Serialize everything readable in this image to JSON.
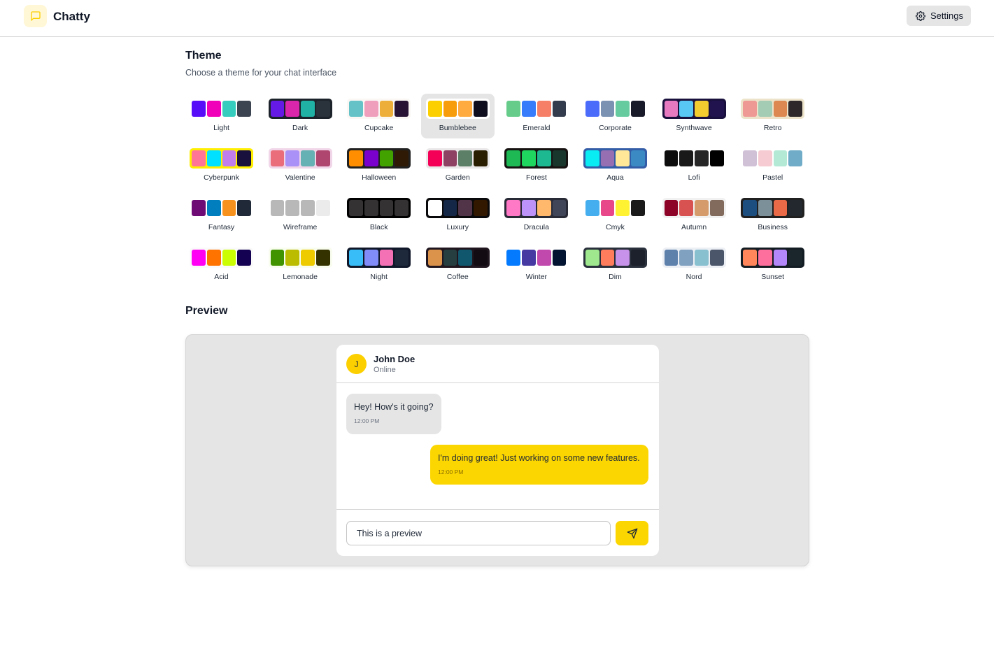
{
  "header": {
    "app_title": "Chatty",
    "settings_label": "Settings",
    "accent": "#fcd600"
  },
  "theme_section": {
    "title": "Theme",
    "subtitle": "Choose a theme for your chat interface",
    "selected": "Bumblebee",
    "themes": [
      {
        "name": "Light",
        "frame": "#ffffff",
        "colors": [
          "#570df8",
          "#f000b8",
          "#37cdbe",
          "#3d4451"
        ]
      },
      {
        "name": "Dark",
        "frame": "#1d232a",
        "colors": [
          "#661ae6",
          "#d926aa",
          "#1fb2a5",
          "#2a323c"
        ]
      },
      {
        "name": "Cupcake",
        "frame": "#faf7f5",
        "colors": [
          "#65c3c8",
          "#ef9fbc",
          "#eeaf3a",
          "#291334"
        ]
      },
      {
        "name": "Bumblebee",
        "frame": "#ffffff",
        "colors": [
          "#fcd000",
          "#f79d0b",
          "#ffab40",
          "#0e0e1f"
        ]
      },
      {
        "name": "Emerald",
        "frame": "#ffffff",
        "colors": [
          "#66cc8a",
          "#377cfb",
          "#f68067",
          "#333c4d"
        ]
      },
      {
        "name": "Corporate",
        "frame": "#ffffff",
        "colors": [
          "#4b6bfb",
          "#7b92b2",
          "#67cba0",
          "#181a2a"
        ]
      },
      {
        "name": "Synthwave",
        "frame": "#1a103d",
        "colors": [
          "#e779c1",
          "#58c7f3",
          "#f3cc30",
          "#20134e"
        ]
      },
      {
        "name": "Retro",
        "frame": "#ece3ca",
        "colors": [
          "#ef9995",
          "#a4cbb4",
          "#dc8850",
          "#2e282a"
        ]
      },
      {
        "name": "Cyberpunk",
        "frame": "#ffee00",
        "colors": [
          "#ff7598",
          "#00e0ff",
          "#c07eec",
          "#1a103d"
        ]
      },
      {
        "name": "Valentine",
        "frame": "#f0d6e8",
        "colors": [
          "#e96d7b",
          "#a991f7",
          "#66b1b3",
          "#af4670"
        ]
      },
      {
        "name": "Halloween",
        "frame": "#212121",
        "colors": [
          "#ff8f00",
          "#7a00cc",
          "#42a300",
          "#2f1b05"
        ]
      },
      {
        "name": "Garden",
        "frame": "#e9e7e7",
        "colors": [
          "#f40056",
          "#8e4162",
          "#5c7f67",
          "#291e00"
        ]
      },
      {
        "name": "Forest",
        "frame": "#171212",
        "colors": [
          "#1eb854",
          "#1fd65f",
          "#1db990",
          "#19362d"
        ]
      },
      {
        "name": "Aqua",
        "frame": "#345da7",
        "colors": [
          "#09ecf3",
          "#966fb3",
          "#ffe999",
          "#3b8ac4"
        ]
      },
      {
        "name": "Lofi",
        "frame": "#ffffff",
        "colors": [
          "#0d0d0d",
          "#1a1919",
          "#262626",
          "#000000"
        ]
      },
      {
        "name": "Pastel",
        "frame": "#ffffff",
        "colors": [
          "#d1c1d7",
          "#f6cbd1",
          "#b4e9d6",
          "#70acc7"
        ]
      },
      {
        "name": "Fantasy",
        "frame": "#ffffff",
        "colors": [
          "#6e0b75",
          "#007ebd",
          "#f7921e",
          "#1f2937"
        ]
      },
      {
        "name": "Wireframe",
        "frame": "#ffffff",
        "colors": [
          "#b8b8b8",
          "#b8b8b8",
          "#b8b8b8",
          "#ebebeb"
        ]
      },
      {
        "name": "Black",
        "frame": "#000000",
        "colors": [
          "#343232",
          "#343232",
          "#343232",
          "#343232"
        ]
      },
      {
        "name": "Luxury",
        "frame": "#09090b",
        "colors": [
          "#ffffff",
          "#152747",
          "#513448",
          "#331800"
        ]
      },
      {
        "name": "Dracula",
        "frame": "#282a36",
        "colors": [
          "#ff79c6",
          "#bd93f9",
          "#ffb86c",
          "#414558"
        ]
      },
      {
        "name": "Cmyk",
        "frame": "#ffffff",
        "colors": [
          "#45aeee",
          "#e8488a",
          "#fff232",
          "#1a1a1a"
        ]
      },
      {
        "name": "Autumn",
        "frame": "#f1f1f1",
        "colors": [
          "#8c0327",
          "#d85251",
          "#d59b6a",
          "#826a5c"
        ]
      },
      {
        "name": "Business",
        "frame": "#202020",
        "colors": [
          "#1c4e80",
          "#7c909a",
          "#ea6947",
          "#23282e"
        ]
      },
      {
        "name": "Acid",
        "frame": "#fafafa",
        "colors": [
          "#ff00f4",
          "#ff7400",
          "#cbfd03",
          "#140152"
        ]
      },
      {
        "name": "Lemonade",
        "frame": "#f8fdef",
        "colors": [
          "#419400",
          "#bbbb00",
          "#eeca00",
          "#343300"
        ]
      },
      {
        "name": "Night",
        "frame": "#0f1729",
        "colors": [
          "#38bdf8",
          "#818cf8",
          "#f471b5",
          "#1e293b"
        ]
      },
      {
        "name": "Coffee",
        "frame": "#20161f",
        "colors": [
          "#db924b",
          "#263e3f",
          "#10576d",
          "#120c12"
        ]
      },
      {
        "name": "Winter",
        "frame": "#ffffff",
        "colors": [
          "#047aff",
          "#463aa2",
          "#c148ac",
          "#021431"
        ]
      },
      {
        "name": "Dim",
        "frame": "#2a303c",
        "colors": [
          "#9fe88d",
          "#ff7d5c",
          "#c792e9",
          "#1c212b"
        ]
      },
      {
        "name": "Nord",
        "frame": "#eceff4",
        "colors": [
          "#5e81ac",
          "#81a1c1",
          "#88c0d0",
          "#4c566a"
        ]
      },
      {
        "name": "Sunset",
        "frame": "#121c22",
        "colors": [
          "#ff865b",
          "#fd6f9c",
          "#b387fa",
          "#1b262c"
        ]
      }
    ]
  },
  "preview": {
    "title": "Preview",
    "contact": {
      "initial": "J",
      "name": "John Doe",
      "status": "Online"
    },
    "messages": [
      {
        "text": "Hey! How's it going?",
        "time": "12:00 PM",
        "sent": false
      },
      {
        "text": "I'm doing great! Just working on some new features.",
        "time": "12:00 PM",
        "sent": true
      }
    ],
    "input_value": "This is a preview"
  }
}
